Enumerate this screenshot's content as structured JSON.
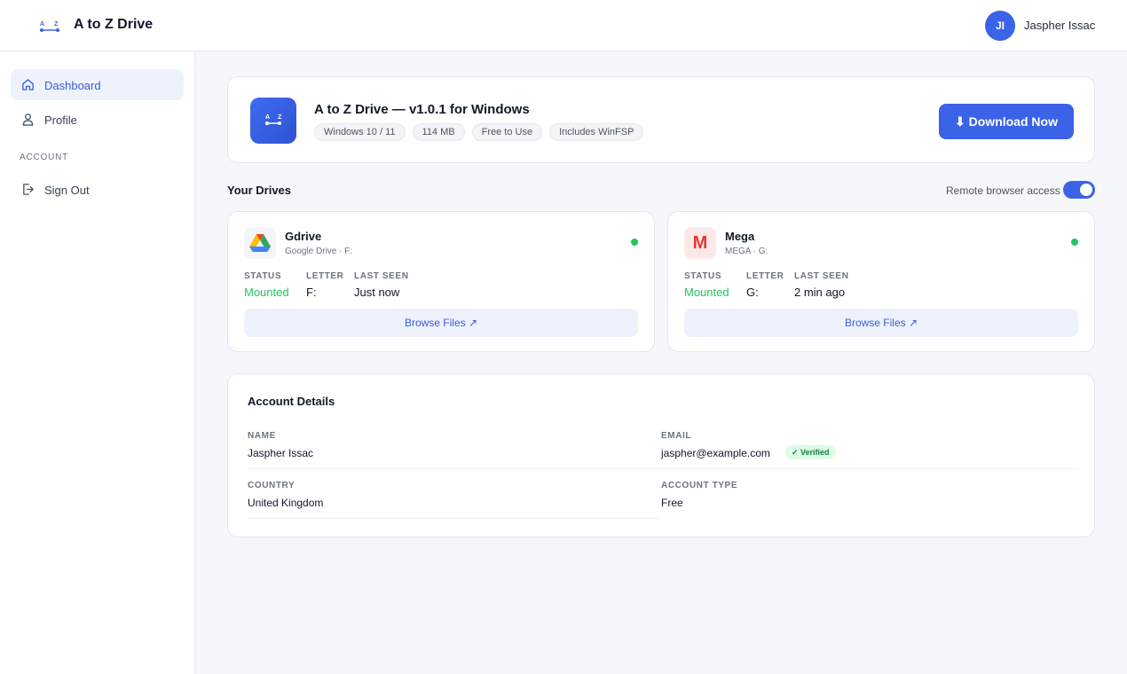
{
  "header": {
    "app_title": "A to Z Drive",
    "user": {
      "initials": "JI",
      "name": "Jaspher Issac"
    }
  },
  "sidebar": {
    "items": [
      {
        "label": "Dashboard",
        "icon": "home-icon",
        "active": true
      },
      {
        "label": "Profile",
        "icon": "user-icon",
        "active": false
      }
    ],
    "section_label": "ACCOUNT",
    "sign_out": {
      "label": "Sign Out",
      "icon": "sign-out-icon"
    }
  },
  "download": {
    "title": "A to Z Drive — v1.0.1 for Windows",
    "tags": [
      "Windows 10 / 11",
      "114 MB",
      "Free to Use",
      "Includes WinFSP"
    ],
    "button_label": "⬇ Download Now"
  },
  "drives": {
    "title": "Your Drives",
    "remote_access_label": "Remote browser access",
    "remote_access_enabled": true,
    "stat_labels": {
      "status": "STATUS",
      "letter": "LETTER",
      "last_seen": "LAST SEEN"
    },
    "items": [
      {
        "name": "Gdrive",
        "subtitle": "Google Drive · F:",
        "icon": "google-drive-icon",
        "online": true,
        "status": "Mounted",
        "letter": "F:",
        "last_seen": "Just now",
        "browse_label": "Browse Files ↗"
      },
      {
        "name": "Mega",
        "subtitle": "MEGA · G:",
        "icon": "mega-icon",
        "logo_letter": "M",
        "online": true,
        "status": "Mounted",
        "letter": "G:",
        "last_seen": "2 min ago",
        "browse_label": "Browse Files ↗"
      }
    ]
  },
  "account": {
    "title": "Account Details",
    "fields": {
      "name": {
        "label": "NAME",
        "value": "Jaspher Issac"
      },
      "email": {
        "label": "EMAIL",
        "value": "jaspher@example.com",
        "badge": "✓ Verified"
      },
      "country": {
        "label": "COUNTRY",
        "value": "United Kingdom"
      },
      "account_type": {
        "label": "ACCOUNT TYPE",
        "value": "Free"
      }
    }
  },
  "colors": {
    "accent": "#3b63e8",
    "online": "#22c55e",
    "mega_red": "#e53935",
    "verified_bg": "#dcfce7"
  }
}
